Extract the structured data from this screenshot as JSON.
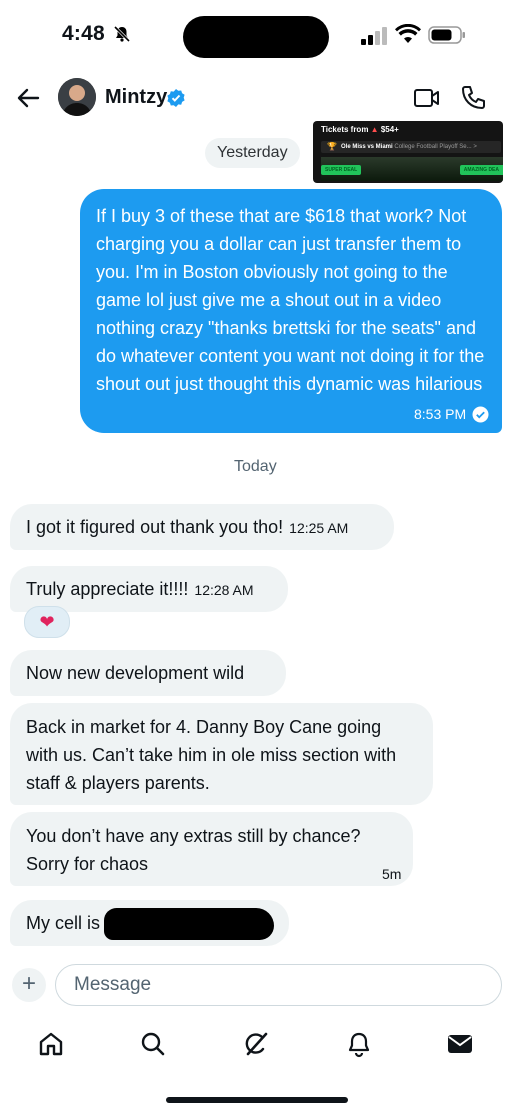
{
  "status_bar": {
    "time": "4:48"
  },
  "header": {
    "name": "Mintzy"
  },
  "ticket_preview": {
    "title": "Tickets from",
    "price": "$54+",
    "event": "Ole Miss vs Miami",
    "event_sub": "College Football Playoff Se...",
    "badge_left": "SUPER DEAL",
    "badge_right": "AMAZING DEA"
  },
  "dates": {
    "yesterday": "Yesterday",
    "today": "Today"
  },
  "sent_message": {
    "text": "If I buy 3 of these that are $618 that work? Not charging you a dollar can just transfer them to you. I'm in Boston obviously not going to the game lol just give me a shout out in a video nothing crazy \"thanks brettski for the seats\" and do whatever content you want not doing it for the shout out just thought this dynamic was hilarious",
    "time": "8:53 PM"
  },
  "received_messages": [
    {
      "text": "I got it figured out thank you tho!",
      "time": "12:25 AM"
    },
    {
      "text": "Truly appreciate it!!!!",
      "time": "12:28 AM",
      "reaction": "❤"
    },
    {
      "text": "Now new development wild",
      "time": ""
    },
    {
      "text": "Back in market for 4. Danny Boy Cane going with us. Can’t take him in ole miss section with staff & players parents.",
      "time": ""
    },
    {
      "text": "You don’t have any extras still by chance? Sorry for chaos",
      "time": "5m"
    },
    {
      "text": "My cell is",
      "time": ""
    }
  ],
  "composer": {
    "placeholder": "Message",
    "plus": "+"
  },
  "tabs": [
    "home-icon",
    "search-icon",
    "grok-icon",
    "notifications-icon",
    "messages-icon"
  ],
  "colors": {
    "accent": "#1d9bf0",
    "bubble_gray": "#eff3f4"
  }
}
